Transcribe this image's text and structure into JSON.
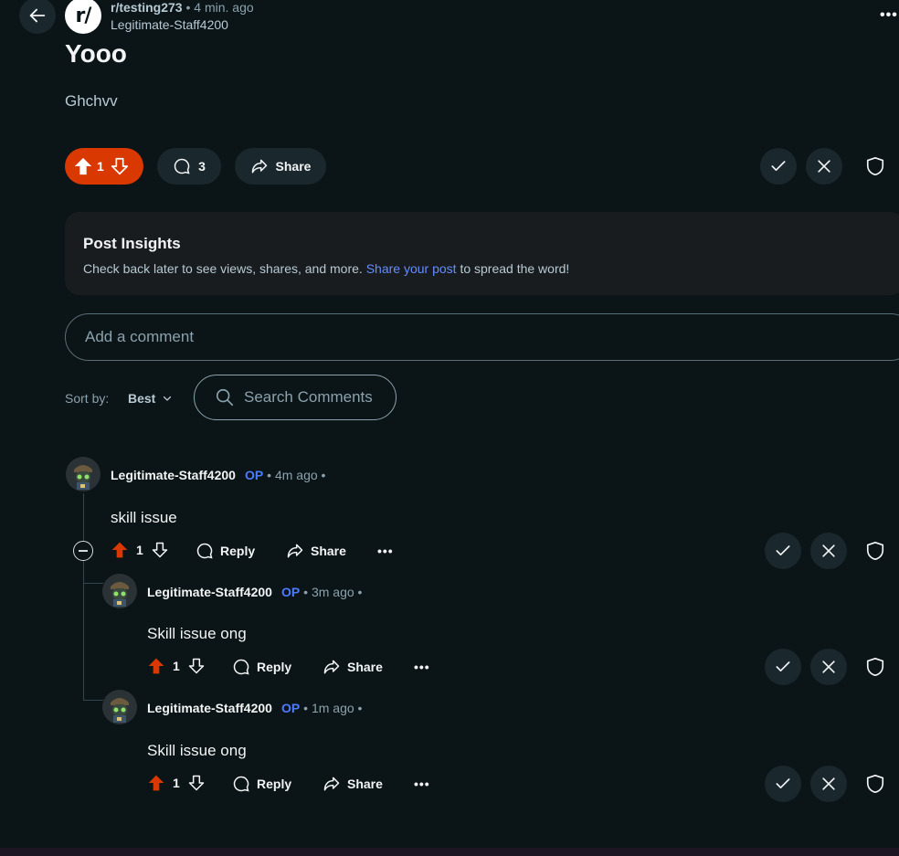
{
  "header": {
    "back_icon": "arrow-left-icon",
    "subreddit_icon_text": "r/",
    "subreddit": "r/testing273",
    "separator": "•",
    "time_ago": "4 min. ago",
    "author": "Legitimate-Staff4200",
    "more_label": "•••"
  },
  "post": {
    "title": "Yooo",
    "body": "Ghchvv",
    "vote_count": "1",
    "comment_count": "3",
    "share_label": "Share",
    "accent_color": "#d93900"
  },
  "insights": {
    "title": "Post Insights",
    "text_before": "Check back later to see views, shares, and more.",
    "link": "Share your post",
    "text_after": "to spread the word!"
  },
  "comment_box": {
    "placeholder": "Add a comment"
  },
  "sort": {
    "label": "Sort by:",
    "value": "Best"
  },
  "search": {
    "placeholder": "Search Comments"
  },
  "comments": [
    {
      "author": "Legitimate-Staff4200",
      "op": "OP",
      "time": "• 4m ago •",
      "text": "skill issue",
      "votes": "1",
      "reply": "Reply",
      "share": "Share",
      "more": "•••"
    },
    {
      "author": "Legitimate-Staff4200",
      "op": "OP",
      "time": "• 3m ago •",
      "text": "Skill issue ong",
      "votes": "1",
      "reply": "Reply",
      "share": "Share",
      "more": "•••"
    },
    {
      "author": "Legitimate-Staff4200",
      "op": "OP",
      "time": "• 1m ago •",
      "text": "Skill issue ong",
      "votes": "1",
      "reply": "Reply",
      "share": "Share",
      "more": "•••"
    }
  ]
}
